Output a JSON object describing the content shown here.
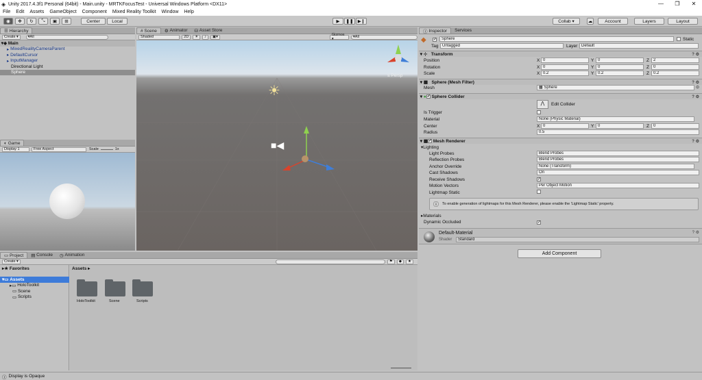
{
  "window": {
    "title": "Unity 2017.4.3f1 Personal (64bit) - Main.unity - MRTKFocusTest - Universal Windows Platform <DX11>",
    "min": "—",
    "max": "❐",
    "close": "✕"
  },
  "menu": [
    "File",
    "Edit",
    "Assets",
    "GameObject",
    "Component",
    "Mixed Reality Toolkit",
    "Window",
    "Help"
  ],
  "toolbar": {
    "pivot": "Center",
    "space": "Local",
    "collab": "Collab ▾",
    "account": "Account",
    "layers": "Layers",
    "layout": "Layout"
  },
  "hierarchy": {
    "tab": "Hierarchy",
    "create": "Create ▾",
    "search": "▾All",
    "scene": "Main",
    "items": [
      "MixedRealityCameraParent",
      "DefaultCursor",
      "InputManager",
      "Directional Light",
      "Sphere"
    ]
  },
  "scene": {
    "tabs": [
      "Scene",
      "Animator",
      "Asset Store"
    ],
    "shading": "Shaded",
    "mode2d": "2D",
    "gizmos": "Gizmos ▾",
    "search": "▾All",
    "persp": "≤ Persp"
  },
  "game": {
    "tab": "Game",
    "display": "Display 1",
    "aspect": "Free Aspect",
    "scale_label": "Scale",
    "scale_value": "1x"
  },
  "project": {
    "tabs": [
      "Project",
      "Console",
      "Animation"
    ],
    "create": "Create ▾",
    "favorites": "Favorites",
    "assets_root": "Assets",
    "tree": [
      "HoloToolkit",
      "Scene",
      "Scripts"
    ],
    "breadcrumb": "Assets ▸",
    "folders": [
      "HoloToolkit",
      "Scene",
      "Scripts"
    ]
  },
  "inspector": {
    "tabs": [
      "Inspector",
      "Services"
    ],
    "object_name": "Sphere",
    "static": "Static",
    "tag_label": "Tag",
    "tag": "Untagged",
    "layer_label": "Layer",
    "layer": "Default",
    "transform": {
      "title": "Transform",
      "rows": [
        {
          "label": "Position",
          "x": "0",
          "y": "0",
          "z": "2"
        },
        {
          "label": "Rotation",
          "x": "0",
          "y": "0",
          "z": "0"
        },
        {
          "label": "Scale",
          "x": "0.2",
          "y": "0.2",
          "z": "0.2"
        }
      ]
    },
    "mesh_filter": {
      "title": "Sphere (Mesh Filter)",
      "mesh_label": "Mesh",
      "mesh": "Sphere"
    },
    "collider": {
      "title": "Sphere Collider",
      "edit": "Edit Collider",
      "trigger": "Is Trigger",
      "material_label": "Material",
      "material": "None (Physic Material)",
      "center_label": "Center",
      "cx": "0",
      "cy": "0",
      "cz": "0",
      "radius_label": "Radius",
      "radius": "0.5"
    },
    "renderer": {
      "title": "Mesh Renderer",
      "lighting": "Lighting",
      "rows": [
        {
          "label": "Light Probes",
          "value": "Blend Probes"
        },
        {
          "label": "Reflection Probes",
          "value": "Blend Probes"
        },
        {
          "label": "Anchor Override",
          "value": "None (Transform)"
        },
        {
          "label": "Cast Shadows",
          "value": "On"
        },
        {
          "label": "Receive Shadows",
          "value": "✓"
        },
        {
          "label": "Motion Vectors",
          "value": "Per Object Motion"
        },
        {
          "label": "Lightmap Static",
          "value": ""
        }
      ],
      "note": "To enable generation of lightmaps for this Mesh Renderer, please enable the 'Lightmap Static' property.",
      "materials": "Materials",
      "dynamic": "Dynamic Occluded"
    },
    "material": {
      "name": "Default-Material",
      "shader_label": "Shader",
      "shader": "Standard"
    },
    "add_component": "Add Component"
  },
  "status": "Display is Opaque"
}
